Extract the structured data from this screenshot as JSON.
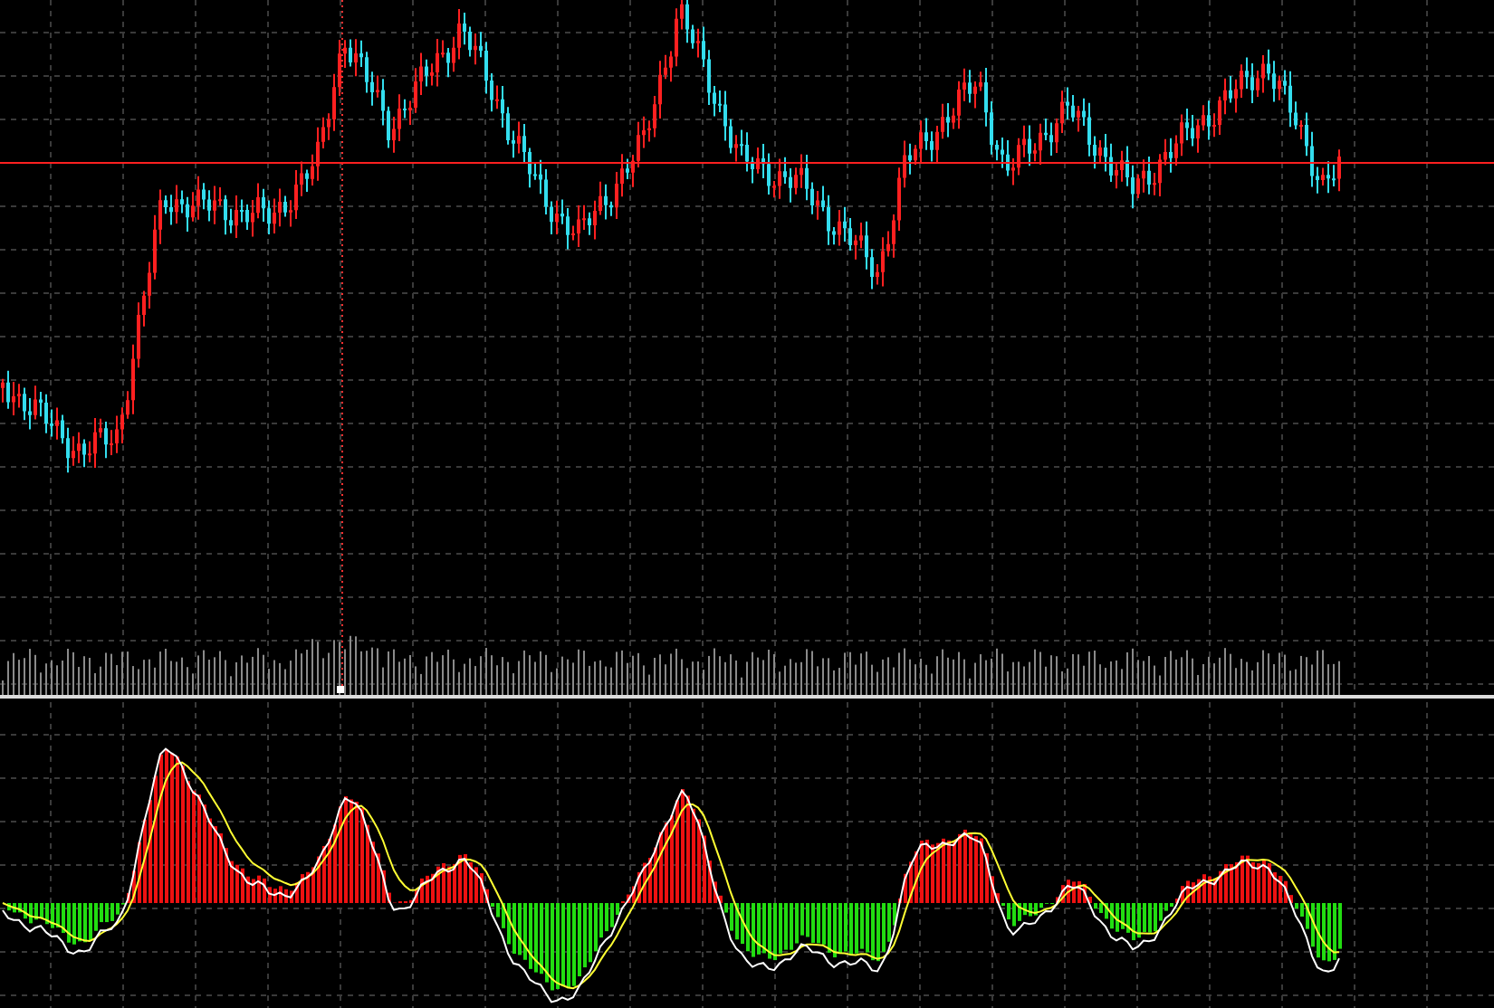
{
  "panels": [
    {
      "kind": "price"
    },
    {
      "kind": "oscillator"
    }
  ]
}
